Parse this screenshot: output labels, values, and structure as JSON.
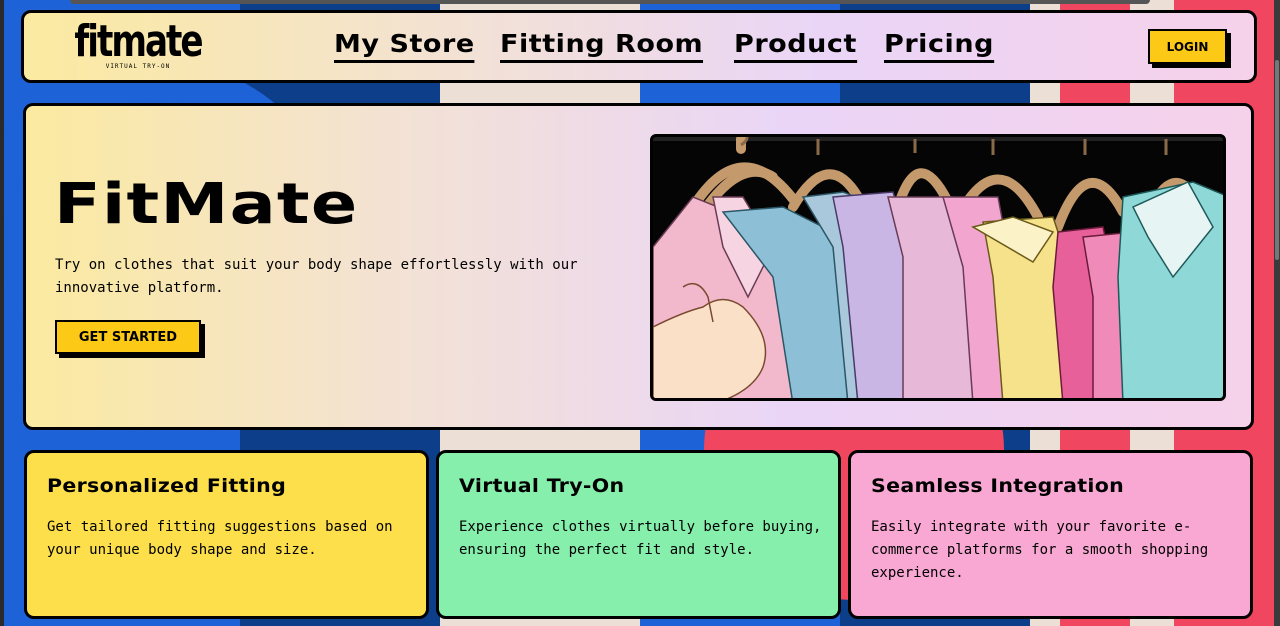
{
  "colors": {
    "accent_yellow": "#fcca16",
    "card_yellow": "#fcdf4b",
    "card_green": "#86efac",
    "card_pink": "#f9a8d4",
    "border": "#000000"
  },
  "nav": {
    "logo": {
      "wordmark": "fitmate",
      "tagline": "VIRTUAL TRY-ON"
    },
    "links": [
      {
        "label": "My Store"
      },
      {
        "label": "Fitting Room"
      },
      {
        "label": "Product"
      },
      {
        "label": "Pricing"
      }
    ],
    "login_label": "LOGIN"
  },
  "hero": {
    "title": "FitMate",
    "description": "Try on clothes that suit your body shape effortlessly with our innovative platform.",
    "cta_label": "GET STARTED",
    "image_icon": "clothes-rack-illustration"
  },
  "features": [
    {
      "title": "Personalized Fitting",
      "description": "Get tailored fitting suggestions based on your unique body shape and size."
    },
    {
      "title": "Virtual Try-On",
      "description": "Experience clothes virtually before buying, ensuring the perfect fit and style."
    },
    {
      "title": "Seamless Integration",
      "description": "Easily integrate with your favorite e-commerce platforms for a smooth shopping experience."
    }
  ]
}
